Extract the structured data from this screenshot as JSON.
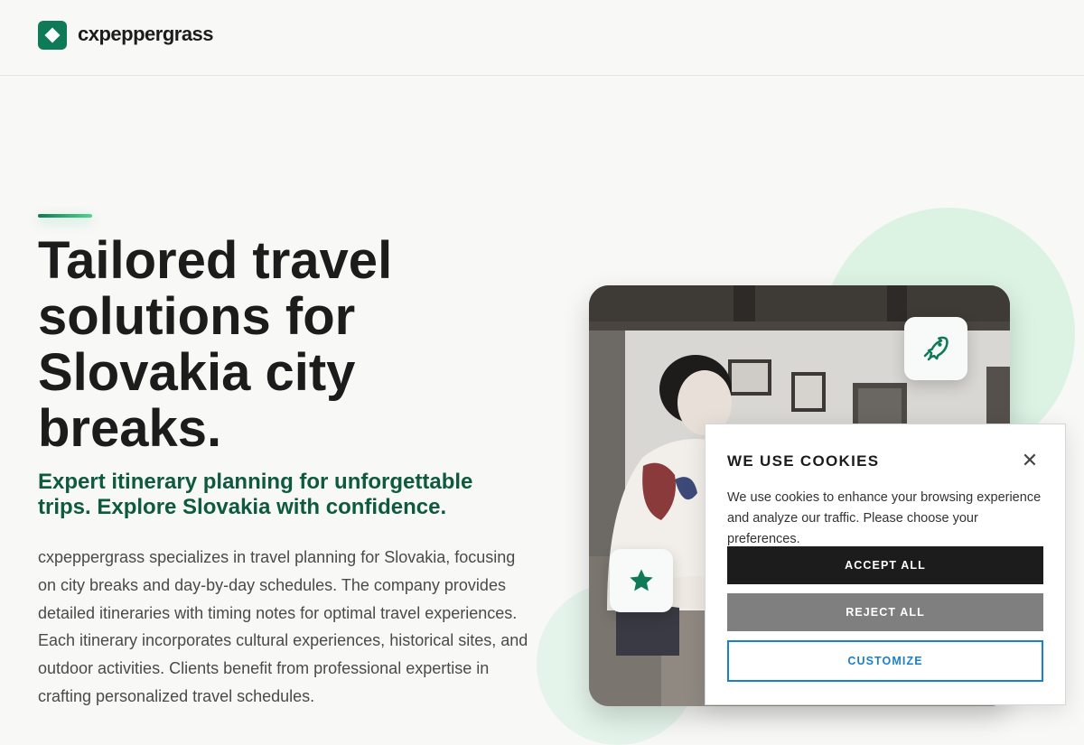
{
  "header": {
    "brand": "cxpeppergrass"
  },
  "hero": {
    "title": "Tailored travel solutions for Slovakia city breaks.",
    "subtitle": "Expert itinerary planning for unforgettable trips. Explore Slovakia with confidence.",
    "description": "cxpeppergrass specializes in travel planning for Slovakia, focusing on city breaks and day-by-day schedules. The company provides detailed itineraries with timing notes for optimal travel experiences. Each itinerary incorporates cultural experiences, historical sites, and outdoor activities. Clients benefit from professional expertise in crafting personalized travel schedules."
  },
  "badges": {
    "top_icon": "rocket-icon",
    "bottom_icon": "star-icon"
  },
  "cookie_banner": {
    "title": "WE USE COOKIES",
    "close": "✕",
    "text": "We use cookies to enhance your browsing experience and analyze our traffic. Please choose your preferences.",
    "accept_label": "ACCEPT ALL",
    "reject_label": "REJECT ALL",
    "customize_label": "CUSTOMIZE"
  },
  "colors": {
    "brand": "#0f7a57",
    "subtitle": "#0d5a3f",
    "accept_bg": "#1c1c1c",
    "reject_bg": "#7f7f7f",
    "customize": "#1a7fd1"
  }
}
